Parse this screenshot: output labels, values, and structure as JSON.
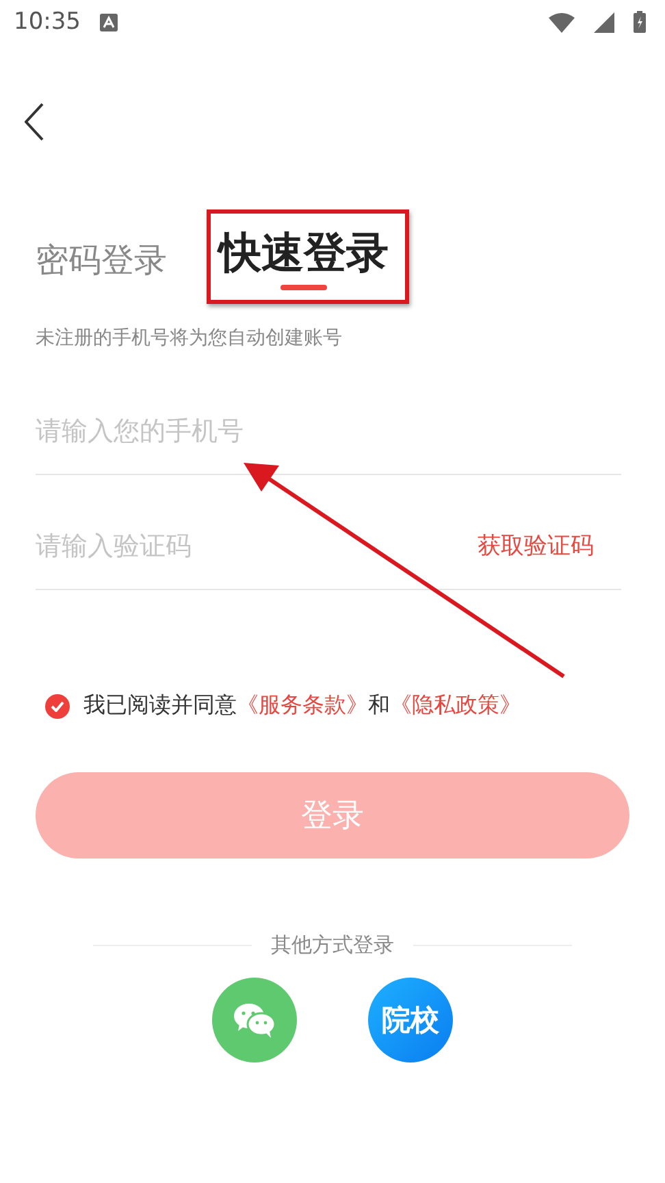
{
  "status_bar": {
    "time": "10:35"
  },
  "tabs": [
    {
      "label": "密码登录",
      "selected": false
    },
    {
      "label": "快速登录",
      "selected": true
    }
  ],
  "hint": "未注册的手机号将为您自动创建账号",
  "fields": [
    {
      "placeholder": "请输入您的手机号"
    },
    {
      "placeholder": "请输入验证码",
      "action": "获取验证码"
    }
  ],
  "agreement": {
    "checked": true,
    "text": "我已阅读并同意",
    "link_1": "《服务条款》",
    "joiner": "和",
    "link_2": "《隐私政策》"
  },
  "login_button": {
    "label": "登录",
    "disabled": true
  },
  "other_login": {
    "title": "其他方式登录",
    "options": [
      {
        "kind": "wechat"
      },
      {
        "kind": "text",
        "label": "院校"
      }
    ]
  },
  "annotation": {
    "highlight": true,
    "arrow": true
  }
}
